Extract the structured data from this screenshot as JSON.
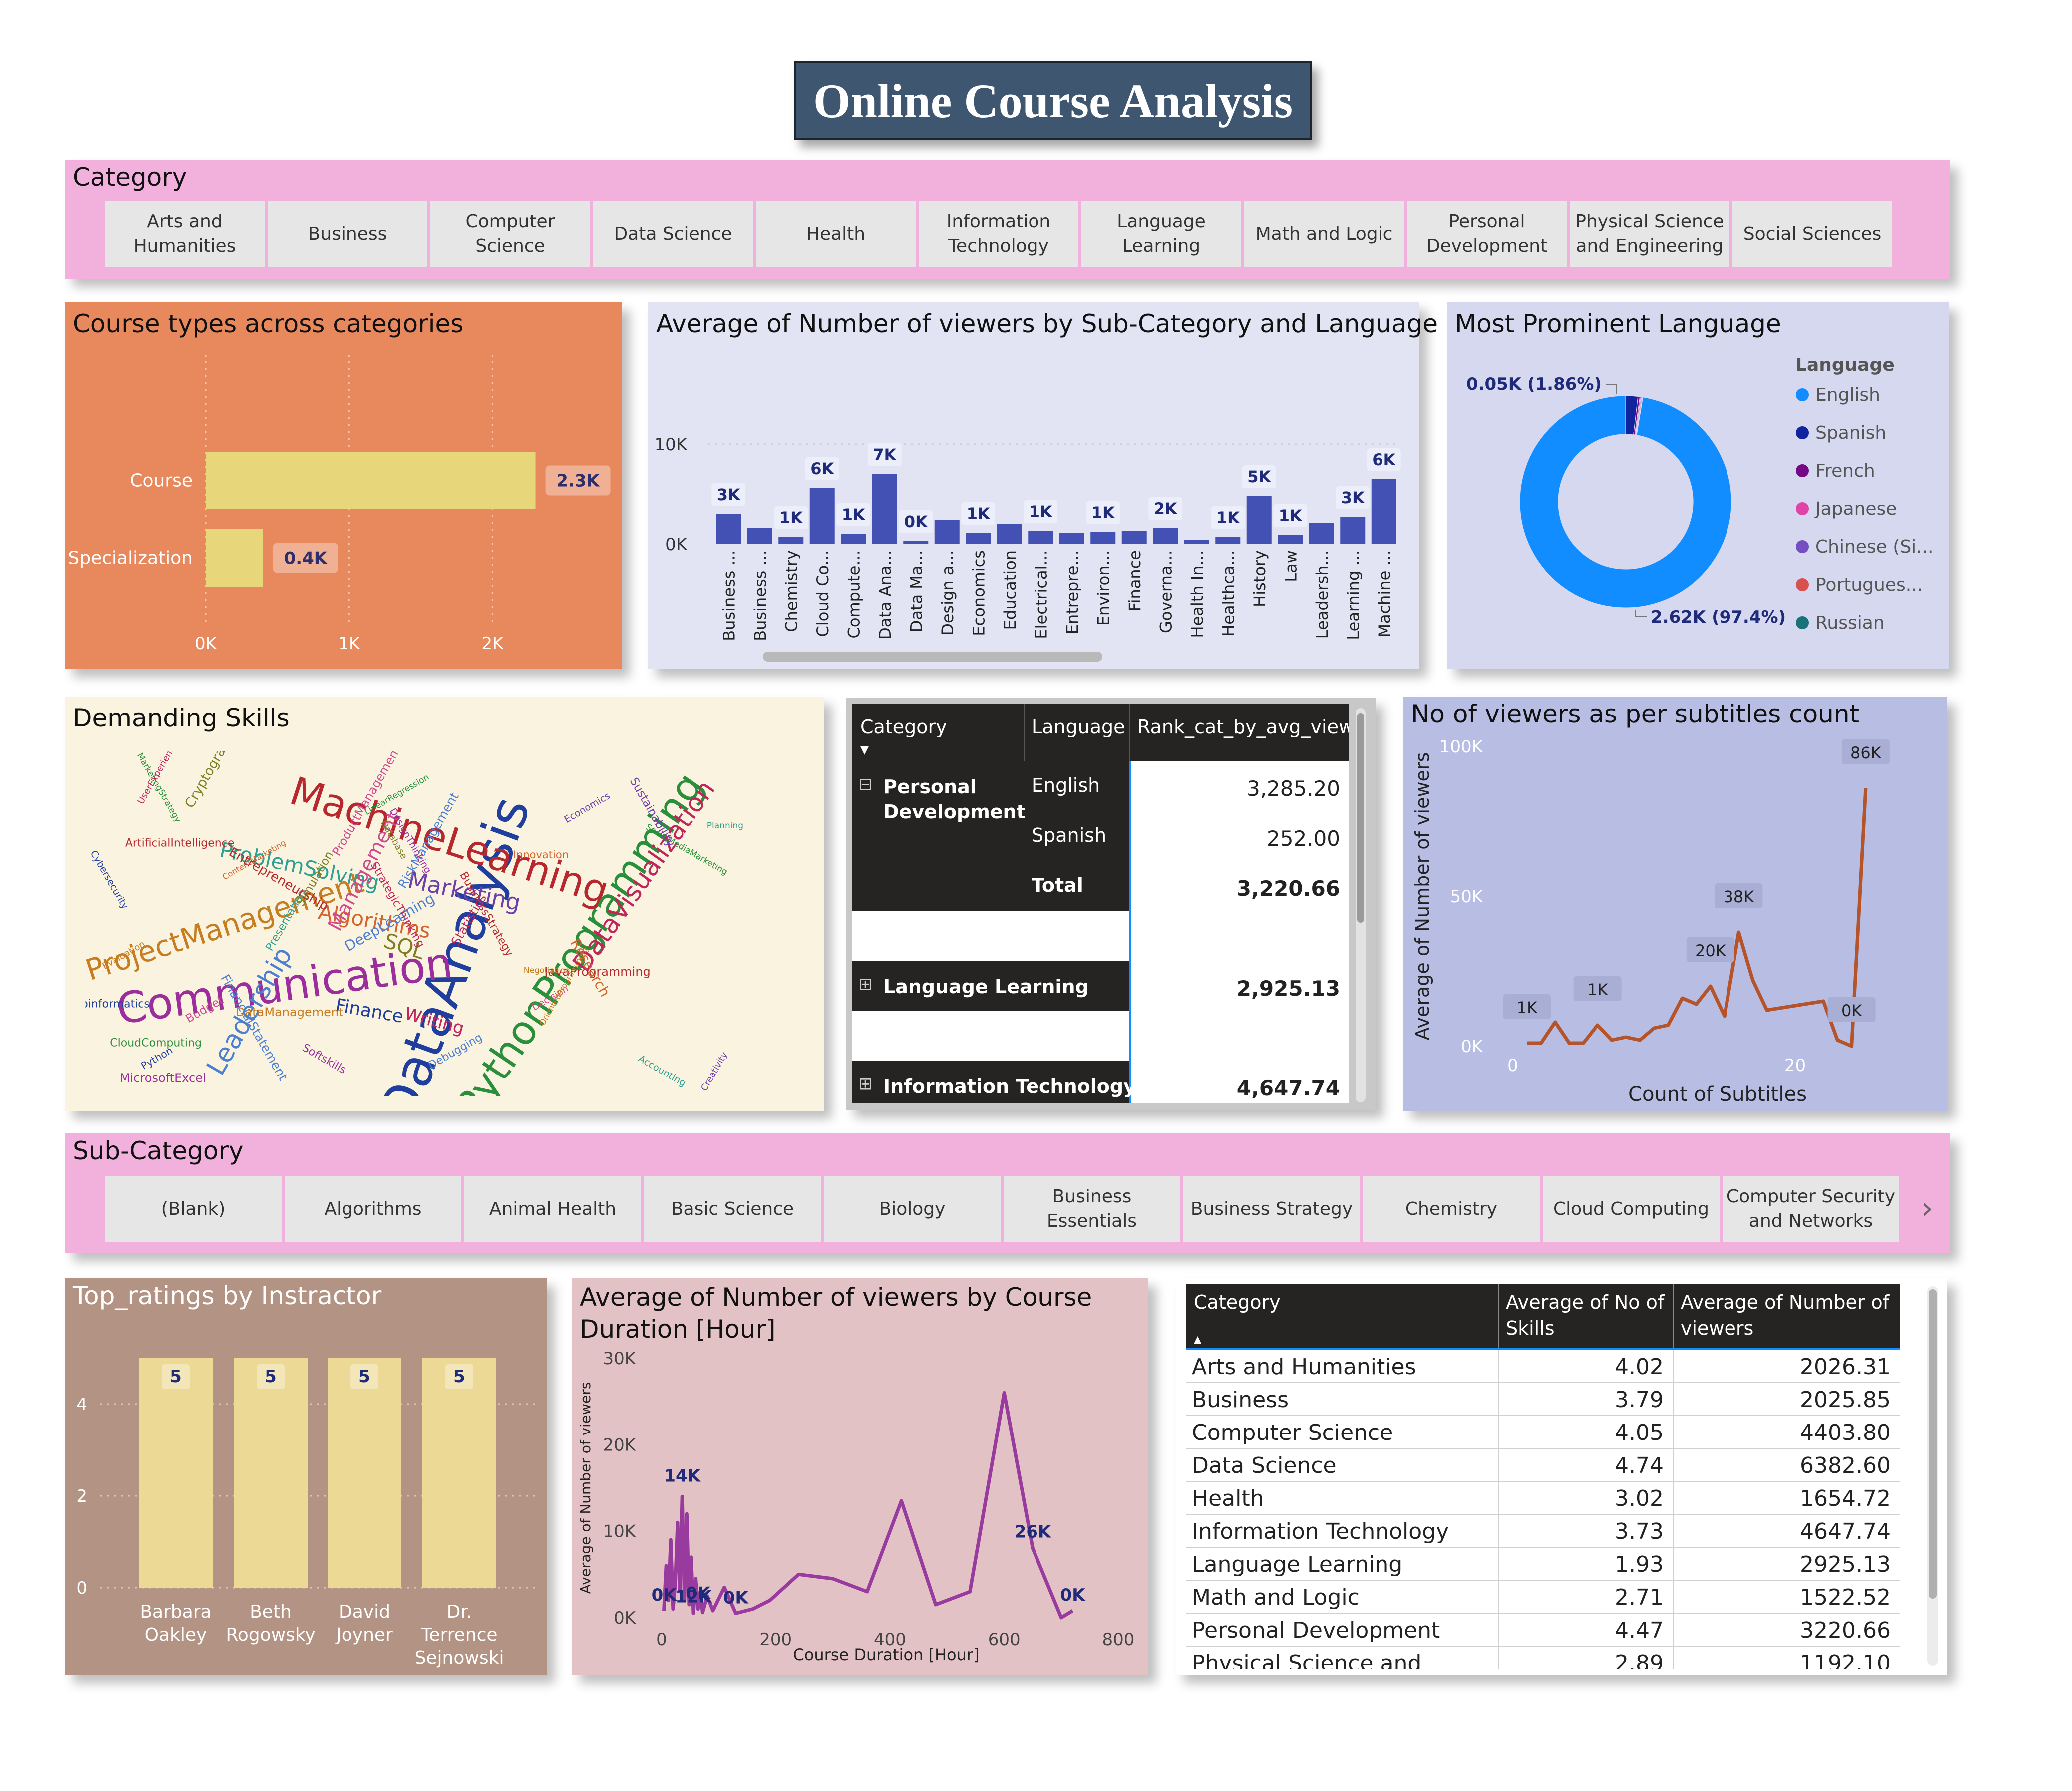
{
  "title": "Online Course Analysis",
  "category_slicer": {
    "title": "Category",
    "items": [
      "Arts and Humanities",
      "Business",
      "Computer Science",
      "Data Science",
      "Health",
      "Information Technology",
      "Language Learning",
      "Math and Logic",
      "Personal Development",
      "Physical Science and Engineering",
      "Social Sciences"
    ]
  },
  "course_types": {
    "title": "Course types across categories",
    "chart_data": {
      "type": "bar",
      "orientation": "horizontal",
      "categories": [
        "Course",
        "Specialization"
      ],
      "values": [
        2300,
        400
      ],
      "data_labels": [
        "2.3K",
        "0.4K"
      ],
      "ticks": [
        "0K",
        "1K",
        "2K"
      ],
      "xlim": [
        0,
        2500
      ],
      "color": "#e8d67a",
      "background": "#e8895d"
    }
  },
  "viewers_subcat": {
    "title": "Average of Number of viewers by Sub-Category and Language",
    "chart_data": {
      "type": "bar",
      "categories": [
        "Business ...",
        "Business ...",
        "Chemistry",
        "Cloud Co...",
        "Compute...",
        "Data Ana...",
        "Data Ma...",
        "Design a...",
        "Economics",
        "Education",
        "Electrical...",
        "Entrepre...",
        "Environ...",
        "Finance",
        "Governa...",
        "Health In...",
        "Healthca...",
        "History",
        "Law",
        "Leadersh...",
        "Learning ...",
        "Machine ..."
      ],
      "values": [
        3000,
        1600,
        700,
        5600,
        1000,
        7000,
        300,
        2400,
        1100,
        2000,
        1300,
        1100,
        1200,
        1300,
        1600,
        400,
        700,
        4800,
        900,
        2100,
        2700,
        6500
      ],
      "data_labels": [
        "3K",
        "",
        "1K",
        "6K",
        "1K",
        "7K",
        "0K",
        "",
        "1K",
        "",
        "1K",
        "",
        "1K",
        "",
        "2K",
        "",
        "1K",
        "5K",
        "1K",
        "",
        "3K",
        "6K"
      ],
      "ticks": [
        "0K",
        "10K"
      ],
      "ylim": [
        0,
        10000
      ],
      "color": "#4350b4",
      "background": "#e2e3f3"
    }
  },
  "language": {
    "title": "Most Prominent Language",
    "legend_title": "Language",
    "legend": [
      "English",
      "Spanish",
      "French",
      "Japanese",
      "Chinese (Si...",
      "Portugues...",
      "Russian"
    ],
    "legend_colors": [
      "#118dff",
      "#12239e",
      "#750985",
      "#e044a7",
      "#744ec2",
      "#d9514e",
      "#197278"
    ],
    "label_small": "0.05K (1.86%)",
    "label_large": "2.62K (97.4%)",
    "chart_data": {
      "type": "pie",
      "donut": true,
      "labels": [
        "English",
        "Spanish",
        "French",
        "Japanese",
        "Chinese (Si...",
        "Portugues...",
        "Russian"
      ],
      "values": [
        2620,
        50,
        8,
        4,
        3,
        3,
        2
      ]
    }
  },
  "skills": {
    "title": "Demanding Skills",
    "words": [
      "DataAnalysis",
      "Communication",
      "MachineLearning",
      "PythonProgramming",
      "ProjectManagement",
      "Leadership",
      "DataVisualization",
      "Marketing",
      "ProblemSolving",
      "Algorithms",
      "SQL",
      "Management",
      "Finance",
      "Writing",
      "ArtificialIntelligence",
      "CloudComputing",
      "DataManagement",
      "RiskManagement",
      "Statistics",
      "Creativity",
      "Planning",
      "Innovation",
      "Database",
      "Budget",
      "Python",
      "DesignThinking",
      "JavaProgramming",
      "LinearRegression",
      "Negotiation",
      "DeepLearning",
      "StrategicThinking",
      "Economics",
      "Accounting",
      "Research",
      "Simulation",
      "Decision",
      "Cybersecurity",
      "MicrosoftExcel",
      "BusinessStrategy",
      "SocialMediaMarketing",
      "OrientedProgramming",
      "FinancialStatement",
      "UserExperience",
      "Sustainability",
      "Presentation",
      "ContentMarketing",
      "Cryptography",
      "ProductManagement",
      "Bioinformatics",
      "Softskills",
      "Entrepreneurship",
      "MarketingStrategy",
      "Evaluation",
      "Debugging",
      "Writing"
    ]
  },
  "pivot": {
    "headers": [
      "Category",
      "Language",
      "Rank_cat_by_avg_view"
    ],
    "rows": [
      {
        "expand": "⊟",
        "category": "Personal Development",
        "language": "English",
        "value": "3,285.20",
        "kind": "detail"
      },
      {
        "expand": "",
        "category": "",
        "language": "Spanish",
        "value": "252.00",
        "kind": "detail"
      },
      {
        "expand": "",
        "category": "",
        "language": "Total",
        "value": "3,220.66",
        "kind": "total"
      },
      {
        "expand": "⊞",
        "category": "Language Learning",
        "language": "",
        "value": "2,925.13",
        "kind": "collapsed"
      },
      {
        "expand": "⊞",
        "category": "Information Technology",
        "language": "",
        "value": "4,647.74",
        "kind": "collapsed"
      }
    ]
  },
  "subtitles": {
    "title": "No of viewers as per subtitles count",
    "chart_data": {
      "type": "line",
      "x": [
        1,
        2,
        3,
        4,
        5,
        6,
        7,
        8,
        9,
        10,
        11,
        12,
        13,
        14,
        15,
        16,
        17,
        18,
        22,
        23,
        24,
        25
      ],
      "y": [
        1000,
        1000,
        8000,
        1000,
        1000,
        7000,
        2000,
        3000,
        2000,
        6000,
        7000,
        16000,
        14000,
        20000,
        10000,
        38000,
        22000,
        12000,
        15000,
        2000,
        0,
        86000
      ],
      "data_labels": [
        {
          "x": 1,
          "text": "1K"
        },
        {
          "x": 6,
          "text": "1K"
        },
        {
          "x": 14,
          "text": "20K"
        },
        {
          "x": 16,
          "text": "38K"
        },
        {
          "x": 24,
          "text": "0K"
        },
        {
          "x": 25,
          "text": "86K"
        }
      ],
      "xlabel": "Count of Subtitles",
      "ylabel": "Average of Number of viewers",
      "xticks": [
        "0",
        "20"
      ],
      "yticks": [
        "0K",
        "50K",
        "100K"
      ],
      "xlim": [
        0,
        29
      ],
      "ylim": [
        0,
        100000
      ],
      "color": "#b5532a",
      "background": "#b7bde3"
    }
  },
  "subcat_slicer": {
    "title": "Sub-Category",
    "items": [
      "(Blank)",
      "Algorithms",
      "Animal Health",
      "Basic Science",
      "Biology",
      "Business Essentials",
      "Business Strategy",
      "Chemistry",
      "Cloud Computing",
      "Computer Security and Networks"
    ]
  },
  "instructors": {
    "title": "Top_ratings by Instractor",
    "chart_data": {
      "type": "bar",
      "categories": [
        "Barbara Oakley",
        "Beth Rogowsky",
        "David Joyner",
        "Dr. Terrence Sejnowski"
      ],
      "values": [
        5,
        5,
        5,
        5
      ],
      "data_labels": [
        "5",
        "5",
        "5",
        "5"
      ],
      "yticks": [
        "0",
        "2",
        "4"
      ],
      "ylim": [
        0,
        5
      ],
      "color": "#ebd995",
      "background": "#b29384"
    }
  },
  "duration": {
    "title": "Average of Number of viewers by Course Duration [Hour]",
    "chart_data": {
      "type": "line",
      "x": [
        4,
        8,
        12,
        16,
        20,
        24,
        28,
        32,
        36,
        40,
        44,
        48,
        52,
        56,
        60,
        64,
        68,
        72,
        80,
        90,
        110,
        130,
        160,
        190,
        240,
        300,
        360,
        420,
        480,
        540,
        600,
        650,
        700,
        720
      ],
      "y": [
        800,
        6000,
        2000,
        9000,
        1000,
        4000,
        11000,
        3000,
        14000,
        2000,
        12000,
        1500,
        7000,
        500,
        4500,
        1000,
        3000,
        600,
        2500,
        800,
        3500,
        500,
        1000,
        2000,
        5000,
        4500,
        3000,
        13500,
        1500,
        3000,
        26000,
        8000,
        0,
        800
      ],
      "data_labels": [
        {
          "x": 36,
          "text": "14K"
        },
        {
          "x": 56,
          "text": "12K"
        },
        {
          "x": 4,
          "text": "0K"
        },
        {
          "x": 64,
          "text": "0K"
        },
        {
          "x": 130,
          "text": "0K"
        },
        {
          "x": 650,
          "text": "26K"
        },
        {
          "x": 720,
          "text": "0K"
        }
      ],
      "xlabel": "Course Duration [Hour]",
      "ylabel": "Average of Number of viewers",
      "xticks": [
        "0",
        "200",
        "400",
        "600",
        "800"
      ],
      "yticks": [
        "0K",
        "10K",
        "20K",
        "30K"
      ],
      "xlim": [
        0,
        800
      ],
      "ylim": [
        0,
        30000
      ],
      "color": "#993b9e",
      "background": "#e3c2c5"
    }
  },
  "table": {
    "headers": [
      "Category",
      "Average of No of Skills",
      "Average of Number of viewers"
    ],
    "rows": [
      [
        "Arts and Humanities",
        "4.02",
        "2026.31"
      ],
      [
        "Business",
        "3.79",
        "2025.85"
      ],
      [
        "Computer Science",
        "4.05",
        "4403.80"
      ],
      [
        "Data Science",
        "4.74",
        "6382.60"
      ],
      [
        "Health",
        "3.02",
        "1654.72"
      ],
      [
        "Information Technology",
        "3.73",
        "4647.74"
      ],
      [
        "Language Learning",
        "1.93",
        "2925.13"
      ],
      [
        "Math and Logic",
        "2.71",
        "1522.52"
      ],
      [
        "Personal Development",
        "4.47",
        "3220.66"
      ],
      [
        "Physical Science and",
        "2.89",
        "1192.10"
      ]
    ]
  }
}
